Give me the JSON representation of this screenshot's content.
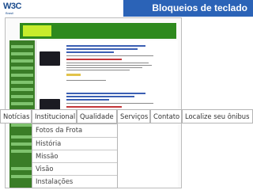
{
  "header": {
    "logo": "W3C",
    "logo_subtitle": "Brasil",
    "title": "Bloqueios de teclado"
  },
  "colors": {
    "title_bar": "#2b63b7",
    "site_green": "#2e8a1e",
    "site_highlight": "#c6ec2c"
  },
  "nav": {
    "items": [
      {
        "label": "Notícias"
      },
      {
        "label": "Institucional"
      },
      {
        "label": "Qualidade"
      },
      {
        "label": "Serviços"
      },
      {
        "label": "Contato"
      },
      {
        "label": "Localize seu ônibus"
      }
    ],
    "open_menu": "Institucional",
    "dropdown": [
      {
        "label": "Fotos da Frota"
      },
      {
        "label": "História"
      },
      {
        "label": "Missão"
      },
      {
        "label": "Visão"
      },
      {
        "label": "Instalações"
      }
    ]
  }
}
